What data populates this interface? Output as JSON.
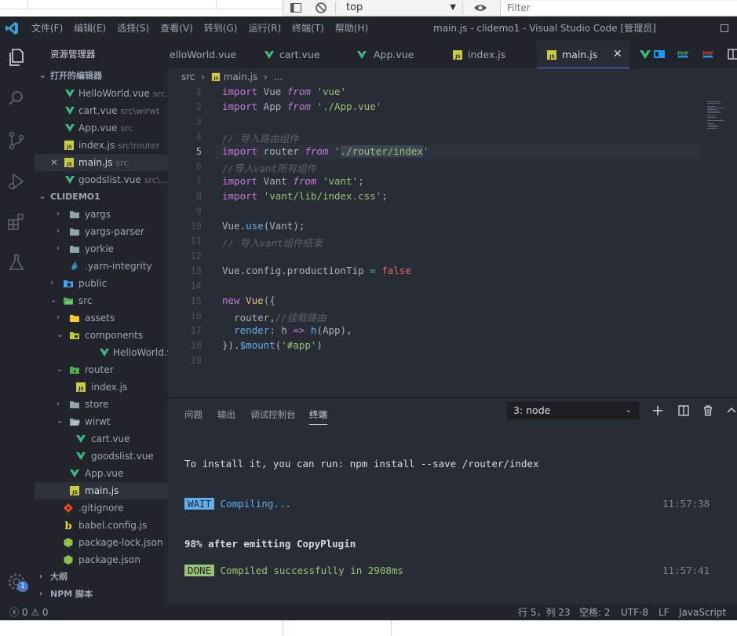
{
  "devtools": {
    "context_select": "top",
    "filter_placeholder": "Filter"
  },
  "titlebar": {
    "menu": [
      "文件(F)",
      "编辑(E)",
      "选择(S)",
      "查看(V)",
      "转到(G)",
      "运行(R)",
      "终端(T)",
      "帮助(H)"
    ],
    "window_title": "main.js - clidemo1 - Visual Studio Code [管理员]"
  },
  "sidebar": {
    "title": "资源管理器",
    "open_editors_label": "打开的编辑器",
    "open_editors": [
      {
        "name": "HelloWorld.vue",
        "desc": "src..."
      },
      {
        "name": "cart.vue",
        "desc": "src\\wirwt"
      },
      {
        "name": "App.vue",
        "desc": "src"
      },
      {
        "name": "index.js",
        "desc": "src\\router"
      },
      {
        "name": "main.js",
        "desc": "src"
      },
      {
        "name": "goodslist.vue",
        "desc": "src\\..."
      }
    ],
    "project_label": "CLIDEMO1",
    "tree": [
      {
        "name": "yargs"
      },
      {
        "name": "yargs-parser"
      },
      {
        "name": "yorkie"
      },
      {
        "name": ".yarn-integrity"
      },
      {
        "name": "public"
      },
      {
        "name": "src"
      },
      {
        "name": "assets"
      },
      {
        "name": "components"
      },
      {
        "name": "HelloWorld.vue"
      },
      {
        "name": "router"
      },
      {
        "name": "index.js"
      },
      {
        "name": "store"
      },
      {
        "name": "wirwt"
      },
      {
        "name": "cart.vue"
      },
      {
        "name": "goodslist.vue"
      },
      {
        "name": "App.vue"
      },
      {
        "name": "main.js"
      },
      {
        "name": ".gitignore"
      },
      {
        "name": "babel.config.js"
      },
      {
        "name": "package-lock.json"
      },
      {
        "name": "package.json"
      }
    ],
    "outline_label": "大纲",
    "npm_label": "NPM 脚本",
    "settings_badge": "1"
  },
  "tabs": [
    {
      "name": "elloWorld.vue"
    },
    {
      "name": "cart.vue"
    },
    {
      "name": "App.vue"
    },
    {
      "name": "index.js"
    },
    {
      "name": "main.js"
    }
  ],
  "breadcrumb": {
    "folder": "src",
    "sep": "›",
    "file": "main.js",
    "rest": "..."
  },
  "editor": {
    "line_numbers": [
      "1",
      "2",
      "3",
      "4",
      "5",
      "6",
      "7",
      "8",
      "9",
      "10",
      "11",
      "12",
      "13",
      "14",
      "15",
      "16",
      "17",
      "18",
      "19"
    ],
    "lines": [
      "import Vue from 'vue'",
      "import App from './App.vue'",
      "",
      "// 导入路由组件",
      "import router from './router/index'",
      "//导入vant所有组件",
      "import Vant from 'vant';",
      "import 'vant/lib/index.css';",
      "",
      "Vue.use(Vant);",
      "// 导入vant组件结束",
      "",
      "Vue.config.productionTip = false",
      "",
      "new Vue({",
      "  router,//挂载路由",
      "  render: h => h(App),",
      "}).$mount('#app')",
      ""
    ]
  },
  "panel": {
    "tabs": [
      "问题",
      "输出",
      "调试控制台",
      "终端"
    ],
    "active_tab": "终端",
    "terminal_select": "3: node",
    "terminal": {
      "line1": "To install it, you can run: npm install --save /router/index",
      "wait_badge": "WAIT",
      "wait_text": "Compiling...",
      "wait_time": "11:57:38",
      "emit_line": "98% after emitting CopyPlugin",
      "done_badge": "DONE",
      "done_text": "Compiled successfully in 2908ms",
      "done_time": "11:57:41"
    }
  },
  "statusbar": {
    "errors": "0",
    "warnings": "0",
    "position": "行 5，列 23",
    "spaces": "空格: 2",
    "encoding": "UTF-8",
    "eol": "LF",
    "language": "JavaScript"
  },
  "colors": {
    "vue_green": "#41b883",
    "js_yellow": "#cbcb41",
    "accent_blue": "#4d78cc",
    "folder": "#90a4ae"
  }
}
